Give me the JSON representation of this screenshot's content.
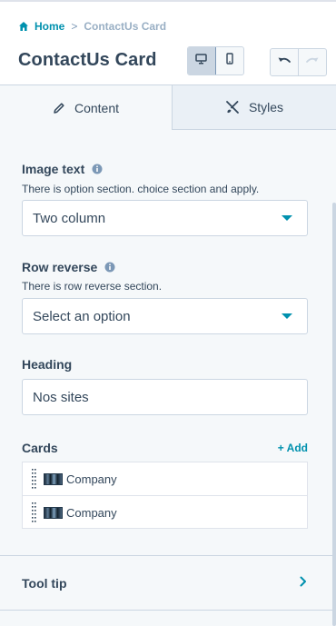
{
  "breadcrumb": {
    "home": "Home",
    "separator": ">",
    "current": "ContactUs Card"
  },
  "header": {
    "title": "ContactUs Card"
  },
  "toolbar": {
    "device_buttons": [
      "desktop-icon",
      "mobile-icon"
    ],
    "history_buttons": [
      "undo-icon",
      "redo-icon"
    ]
  },
  "tabs": [
    {
      "label": "Content",
      "icon": "pencil-icon",
      "active": true
    },
    {
      "label": "Styles",
      "icon": "styles-icon",
      "active": false
    }
  ],
  "fields": {
    "image_text": {
      "label": "Image text",
      "help": "There is option section. choice section and apply.",
      "value": "Two column"
    },
    "row_reverse": {
      "label": "Row reverse",
      "help": "There is row reverse section.",
      "placeholder": "Select an option"
    },
    "heading": {
      "label": "Heading",
      "value": "Nos sites"
    },
    "cards": {
      "label": "Cards",
      "add_label": "+ Add",
      "items": [
        {
          "label": "Company"
        },
        {
          "label": "Company"
        }
      ]
    },
    "tooltip": {
      "label": "Tool tip"
    }
  },
  "colors": {
    "accent": "#0091ae",
    "text": "#33475b",
    "border": "#cbd6e2",
    "panel_bg": "#f5f8fa"
  }
}
